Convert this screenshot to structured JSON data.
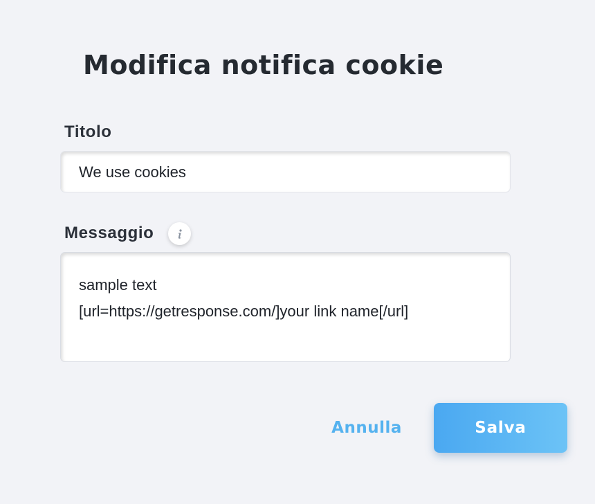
{
  "dialog": {
    "title": "Modifica notifica cookie"
  },
  "fields": {
    "title_label": "Titolo",
    "title_value": "We use cookies",
    "message_label": "Messaggio",
    "message_lines": [
      "sample text",
      "[url=https://getresponse.com/]your link name[/url]"
    ],
    "info_icon": "info-icon"
  },
  "actions": {
    "cancel_label": "Annulla",
    "save_label": "Salva"
  },
  "colors": {
    "background": "#f2f3f7",
    "accent": "#4aa8f1",
    "link": "#55b2ef",
    "text": "#252a31"
  }
}
